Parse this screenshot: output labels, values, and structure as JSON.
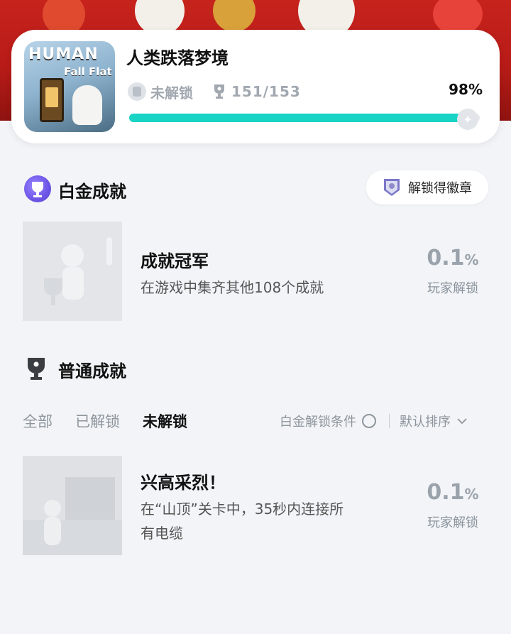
{
  "game": {
    "title": "人类跌落梦境",
    "cover_title": "HUMAN",
    "cover_subtitle": "Fall Flat",
    "status": "未解锁",
    "trophy_count": "151/153",
    "progress_percent_text": "98%",
    "progress_fraction": 0.98
  },
  "platinum": {
    "section_title": "白金成就",
    "badge_button_label": "解锁得徽章",
    "achievement": {
      "title": "成就冠军",
      "description": "在游戏中集齐其他108个成就",
      "percent_value": "0.1",
      "percent_unit": "%",
      "percent_label": "玩家解锁"
    }
  },
  "normal": {
    "section_title": "普通成就",
    "filters": [
      "全部",
      "已解锁",
      "未解锁"
    ],
    "active_filter_index": 2,
    "condition_label": "白金解锁条件",
    "sort_label": "默认排序",
    "achievements": [
      {
        "title": "兴高采烈！",
        "description_line1": "在“山顶”关卡中，35秒内连接所",
        "description_line2": "有电缆",
        "percent_value": "0.1",
        "percent_unit": "%",
        "percent_label": "玩家解锁"
      }
    ]
  },
  "colors": {
    "accent": "#19d3c5",
    "banner_red": "#c7231d",
    "platinum_purple": "#6c55e6"
  }
}
